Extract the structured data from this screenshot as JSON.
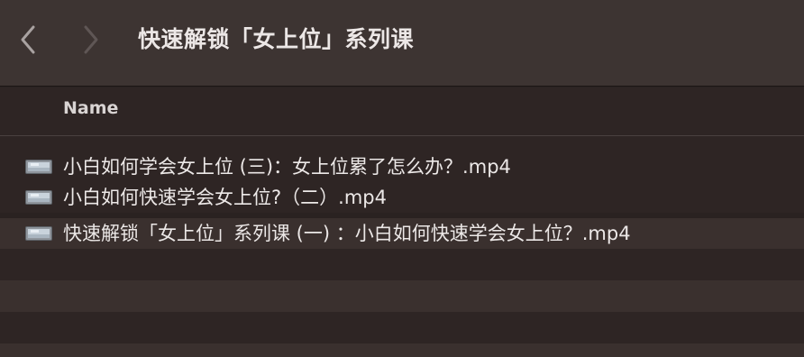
{
  "window": {
    "title": "快速解锁「女上位」系列课"
  },
  "toolbar": {
    "back_icon": "chevron-left-icon",
    "forward_icon": "chevron-right-icon"
  },
  "columns": {
    "name_header": "Name"
  },
  "files": [
    {
      "name": "小白如何学会女上位 (三)：女上位累了怎么办？.mp4",
      "icon": "video-file-icon"
    },
    {
      "name": "小白如何快速学会女上位?（二）.mp4",
      "icon": "video-file-icon"
    },
    {
      "name": "快速解锁「女上位」系列课 (一) ：小白如何快速学会女上位？.mp4",
      "icon": "video-file-icon"
    }
  ],
  "colors": {
    "toolbar_bg": "#3d3432",
    "list_bg": "#2e2524",
    "row_alt_bg": "#3a302e",
    "text": "#ece8e7"
  }
}
